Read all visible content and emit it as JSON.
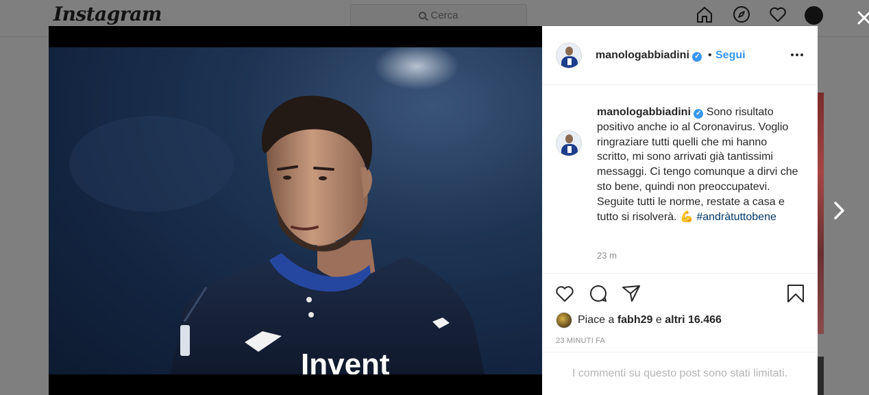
{
  "app": {
    "logo": "Instagram",
    "search_placeholder": "Cerca"
  },
  "nav_icons": [
    "home-icon",
    "explore-compass-icon",
    "heart-icon",
    "profile-avatar"
  ],
  "post": {
    "username": "manologabbiadini",
    "verified": true,
    "separator": "•",
    "follow_label": "Segui",
    "caption_text": "Sono risultato positivo anche io al Coronavirus. Voglio ringraziare tutti quelli che mi hanno scritto, mi sono arrivati già tantissimi messaggi. Ci tengo comunque a dirvi che sto bene, quindi non preoccupatevi. Seguite tutti le norme, restate a casa e tutto si risolverà.",
    "caption_emoji": "💪",
    "hashtag": "#andràtuttobene",
    "caption_time": "23 m",
    "jersey_text": "Invent",
    "likes": {
      "prefix": "Piace a",
      "first_user": "fabh29",
      "connector": "e",
      "others": "altri 16.466"
    },
    "timestamp": "23 MINUTI FA",
    "comments_limited": "I commenti su questo post sono stati limitati."
  },
  "colors": {
    "accent_blue": "#3897f0",
    "hashtag": "#00376b",
    "jersey_navy": "#16223a",
    "overlay": "#7f7f7f"
  }
}
